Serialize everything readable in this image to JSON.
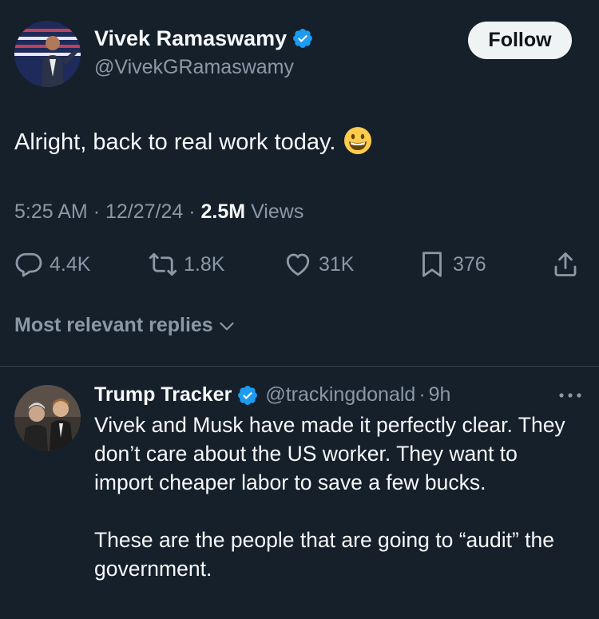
{
  "tweet": {
    "author_name": "Vivek Ramaswamy",
    "author_handle": "@VivekGRamaswamy",
    "follow_label": "Follow",
    "text": "Alright, back to real work today.",
    "emoji": "grinning-face-icon",
    "time": "5:25 AM",
    "date": "12/27/24",
    "separator": "·",
    "views_count": "2.5M",
    "views_label": "Views",
    "stats": {
      "replies": "4.4K",
      "reposts": "1.8K",
      "likes": "31K",
      "bookmarks": "376"
    }
  },
  "replies_sort_label": "Most relevant replies",
  "reply": {
    "name": "Trump Tracker",
    "handle": "@trackingdonald",
    "separator": "·",
    "time": "9h",
    "paragraph1": "Vivek and Musk have made it perfectly clear. They don’t care about the US worker. They want to import cheaper labor to save a few bucks.",
    "paragraph2": "These are the people that are going to “audit” the government."
  },
  "colors": {
    "background": "#15202b",
    "text": "#f7f9f9",
    "muted": "#8b98a5",
    "verified": "#1d9bf0",
    "divider": "#38444d"
  }
}
